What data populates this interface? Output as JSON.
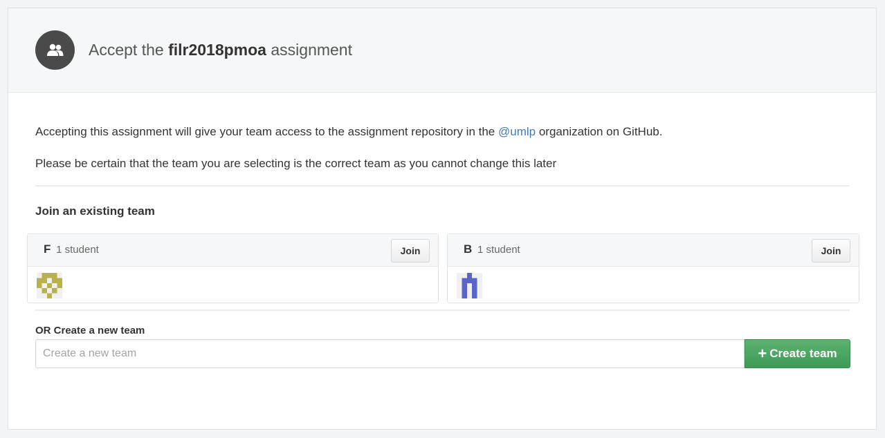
{
  "header": {
    "title_prefix": "Accept the",
    "assignment_name": "filr2018pmoa",
    "title_suffix": "assignment",
    "icon": "people-icon"
  },
  "intro": {
    "line1_prefix": "Accepting this assignment will give your team access to the assignment repository in the",
    "org_link": "@umlp",
    "line1_suffix": "organization on GitHub.",
    "line2": "Please be certain that the team you are selecting is the correct team as you cannot change this later"
  },
  "join_section": {
    "title": "Join an existing team",
    "teams": [
      {
        "name": "F",
        "count": "1 student",
        "join_label": "Join",
        "avatar_color": "#b9b24a"
      },
      {
        "name": "B",
        "count": "1 student",
        "join_label": "Join",
        "avatar_color": "#5b64c9"
      }
    ]
  },
  "create_section": {
    "label": "OR Create a new team",
    "placeholder": "Create a new team",
    "value": "",
    "button_label": "Create team",
    "button_color": "#4caa63"
  },
  "colors": {
    "link": "#4078c0",
    "header_bg": "#f6f7f9",
    "avatar_bg": "#4a4a4a"
  }
}
